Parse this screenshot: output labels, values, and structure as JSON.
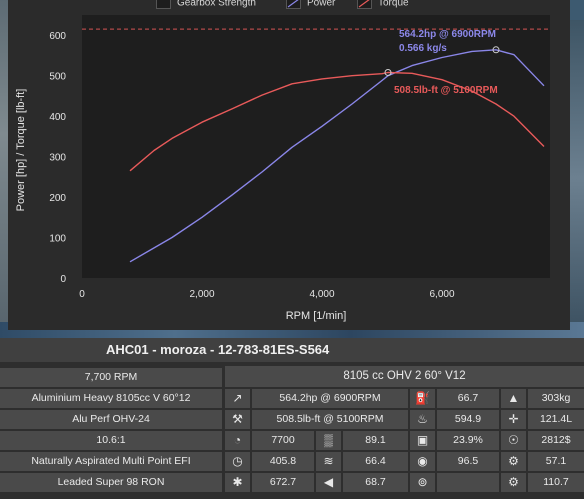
{
  "legend": {
    "items": [
      "Gearbox Strength",
      "Power",
      "Torque"
    ]
  },
  "chart_data": {
    "type": "line",
    "xlabel": "RPM [1/min]",
    "ylabel": "Power [hp] / Torque [lb-ft]",
    "xlim": [
      0,
      7800
    ],
    "ylim": [
      0,
      650
    ],
    "x_ticks": [
      "0",
      "2,000",
      "4,000",
      "6,000"
    ],
    "y_ticks": [
      "0",
      "100",
      "200",
      "300",
      "400",
      "500",
      "600"
    ],
    "grid": false,
    "reference_line": {
      "name": "Gearbox Strength",
      "value": 615,
      "color": "#b04848"
    },
    "series": [
      {
        "name": "Power",
        "color": "#8a86e8",
        "x": [
          800,
          1500,
          2000,
          2500,
          3000,
          3500,
          4000,
          4500,
          5000,
          5100,
          5500,
          6000,
          6500,
          6900,
          7200,
          7700
        ],
        "values": [
          40,
          100,
          150,
          205,
          262,
          323,
          375,
          430,
          488,
          500,
          525,
          545,
          560,
          564,
          552,
          475
        ]
      },
      {
        "name": "Torque",
        "color": "#e85a5a",
        "x": [
          800,
          1200,
          1500,
          2000,
          2500,
          3000,
          3500,
          4000,
          4500,
          5000,
          5100,
          5500,
          6000,
          6500,
          6900,
          7200,
          7700
        ],
        "values": [
          265,
          315,
          345,
          385,
          418,
          452,
          480,
          492,
          500,
          505,
          508,
          506,
          490,
          462,
          430,
          400,
          325
        ]
      }
    ],
    "annotations": {
      "power_peak": "564.2hp @ 6900RPM",
      "airflow": "0.566 kg/s",
      "torque_peak": "508.5lb-ft @ 5100RPM"
    }
  },
  "panel": {
    "title": "AHC01 - moroza - 12-783-81ES-S564",
    "rpm_limit": "7,700 RPM",
    "engine_summary": "8105 cc OHV 2 60° V12",
    "left_rows": [
      "Aluminium Heavy 8105cc V 60°12",
      "Alu Perf OHV-24",
      "10.6:1",
      "Naturally Aspirated Multi Point EFI",
      "Leaded Super 98 RON"
    ],
    "power_text": "564.2hp @ 6900RPM",
    "torque_text": "508.5lb-ft @ 5100RPM",
    "stats": {
      "redline_rpm": "7700",
      "smoothness": "89.1",
      "efficiency_pct": "23.9%",
      "cost": "2812$",
      "responsiveness": "405.8",
      "emissions": "66.4",
      "fuel_quality": "96.5",
      "service": "57.1",
      "cooling": "672.7",
      "noise": "68.7",
      "reliability": "66.7",
      "economy": "594.9",
      "weight": "303kg",
      "length": "121.4L",
      "production_units": "110.7"
    }
  },
  "icons": [
    "power-icon",
    "torque-icon",
    "gauge-icon",
    "radiator-icon",
    "rpm-icon",
    "emissions-icon",
    "cooling-icon",
    "speaker-icon",
    "fuel-pump-icon",
    "oil-can-icon",
    "fuel-can-icon",
    "eye-icon",
    "weight-icon",
    "dimensions-icon",
    "money-icon",
    "service-icon",
    "gear-icon"
  ]
}
